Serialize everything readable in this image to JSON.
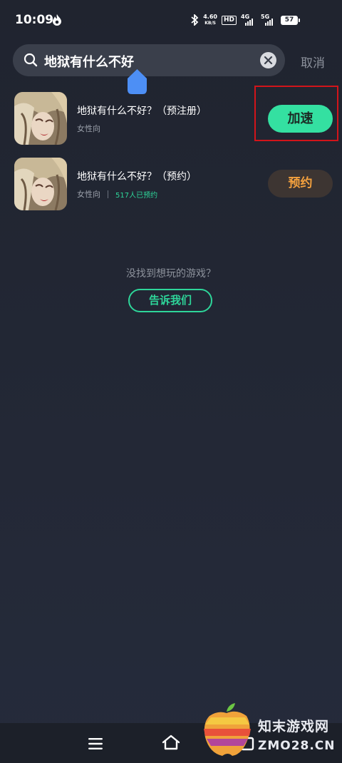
{
  "status_bar": {
    "time": "10:09",
    "net_speed_value": "4.60",
    "net_speed_unit": "KB/S",
    "hd_label": "HD",
    "sig1_label": "4G",
    "sig2_label": "5G",
    "battery": "57"
  },
  "search": {
    "query": "地狱有什么不好",
    "cancel_label": "取消"
  },
  "results": [
    {
      "title": "地狱有什么不好？（预注册）",
      "tag": "女性向",
      "extra": "",
      "action_label": "加速"
    },
    {
      "title": "地狱有什么不好？（预约）",
      "tag": "女性向",
      "extra": "517人已预约",
      "action_label": "预约"
    }
  ],
  "empty_hint": {
    "text": "没找到想玩的游戏？",
    "button_label": "告诉我们"
  },
  "watermark": {
    "cn": "知末游戏网",
    "en": "ZMO28.CN"
  },
  "colors": {
    "accent_green": "#34e0a1",
    "reserve_orange": "#f4a13e",
    "highlight_red": "#d2141a"
  }
}
